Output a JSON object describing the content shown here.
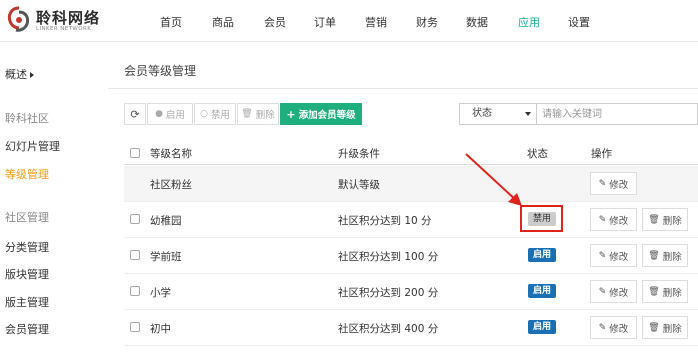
{
  "logo": {
    "name_cn": "聆科网络",
    "name_en": "LINKER NETWORK"
  },
  "nav": [
    {
      "label": "首页"
    },
    {
      "label": "商品"
    },
    {
      "label": "会员"
    },
    {
      "label": "订单"
    },
    {
      "label": "营销"
    },
    {
      "label": "财务"
    },
    {
      "label": "数据"
    },
    {
      "label": "应用",
      "active": true
    },
    {
      "label": "设置"
    }
  ],
  "sidebar": {
    "overview": "概述",
    "group1": "聆科社区",
    "items1": [
      "幻灯片管理",
      "等级管理"
    ],
    "group2": "社区管理",
    "items2": [
      "分类管理",
      "版块管理",
      "版主管理",
      "会员管理"
    ]
  },
  "page_title": "会员等级管理",
  "toolbar": {
    "enable": "启用",
    "disable": "禁用",
    "delete": "删除",
    "add": "添加会员等级"
  },
  "filter": {
    "status_label": "状态",
    "search_placeholder": "请输入关键词"
  },
  "table": {
    "headers": {
      "name": "等级名称",
      "condition": "升级条件",
      "status": "状态",
      "action": "操作"
    },
    "rows": [
      {
        "name": "社区粉丝",
        "condition": "默认等级",
        "status": "",
        "deletable": false
      },
      {
        "name": "幼稚园",
        "condition": "社区积分达到 10 分",
        "status": "禁用",
        "deletable": true
      },
      {
        "name": "学前班",
        "condition": "社区积分达到 100 分",
        "status": "启用",
        "deletable": true
      },
      {
        "name": "小学",
        "condition": "社区积分达到 200 分",
        "status": "启用",
        "deletable": true
      },
      {
        "name": "初中",
        "condition": "社区积分达到 400 分",
        "status": "启用",
        "deletable": true
      }
    ],
    "edit_label": "修改",
    "delete_label": "删除"
  },
  "colors": {
    "accent": "#19b394",
    "add_button": "#1fae7e",
    "badge_enabled": "#1a6fb5",
    "badge_disabled": "#cccccc",
    "sidebar_active": "#f39c12",
    "annotation": "#e0241b"
  },
  "icons": {
    "refresh": "refresh-icon",
    "edit": "pencil-icon",
    "delete": "trash-icon",
    "add": "plus-icon"
  }
}
